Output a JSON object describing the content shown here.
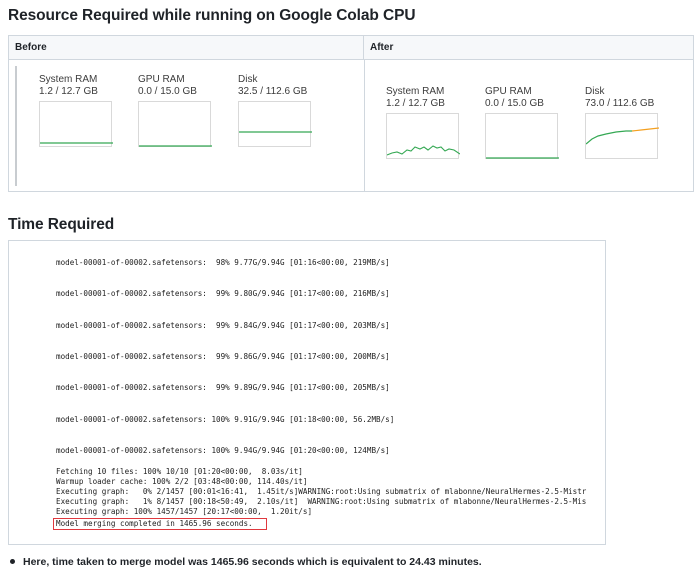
{
  "titles": {
    "resource": "Resource Required while running on Google Colab CPU",
    "time": "Time Required"
  },
  "table": {
    "before_header": "Before",
    "after_header": "After",
    "before": [
      {
        "name": "System RAM",
        "value": "1.2 / 12.7 GB"
      },
      {
        "name": "GPU RAM",
        "value": "0.0 / 15.0 GB"
      },
      {
        "name": "Disk",
        "value": "32.5 / 112.6 GB"
      }
    ],
    "after": [
      {
        "name": "System RAM",
        "value": "1.2 / 12.7 GB"
      },
      {
        "name": "GPU RAM",
        "value": "0.0 / 15.0 GB"
      },
      {
        "name": "Disk",
        "value": "73.0 / 112.6 GB"
      }
    ]
  },
  "colors": {
    "line_green": "#34a853",
    "line_orange": "#f4a020"
  },
  "console": {
    "lines": [
      "model-00001-of-00002.safetensors:  98% 9.77G/9.94G [01:16<00:00, 219MB/s]",
      "model-00001-of-00002.safetensors:  99% 9.80G/9.94G [01:17<00:00, 216MB/s]",
      "model-00001-of-00002.safetensors:  99% 9.84G/9.94G [01:17<00:00, 203MB/s]",
      "model-00001-of-00002.safetensors:  99% 9.86G/9.94G [01:17<00:00, 200MB/s]",
      "model-00001-of-00002.safetensors:  99% 9.89G/9.94G [01:17<00:00, 205MB/s]",
      "model-00001-of-00002.safetensors: 100% 9.91G/9.94G [01:18<00:00, 56.2MB/s]",
      "model-00001-of-00002.safetensors: 100% 9.94G/9.94G [01:20<00:00, 124MB/s]"
    ],
    "tail": [
      "Fetching 10 files: 100% 10/10 [01:20<00:00,  8.03s/it]",
      "Warmup loader cache: 100% 2/2 [03:48<00:00, 114.40s/it]",
      "Executing graph:   0% 2/1457 [00:01<16:41,  1.45it/s]WARNING:root:Using submatrix of mlabonne/NeuralHermes-2.5-Mistr",
      "Executing graph:   1% 8/1457 [00:18<50:49,  2.10s/it]  WARNING:root:Using submatrix of mlabonne/NeuralHermes-2.5-Mis",
      "Executing graph: 100% 1457/1457 [20:17<00:00,  1.20it/s]",
      "Model merging completed in 1465.96 seconds."
    ]
  },
  "note": "Here, time taken to merge model was 1465.96 seconds which is equivalent to 24.43 minutes."
}
